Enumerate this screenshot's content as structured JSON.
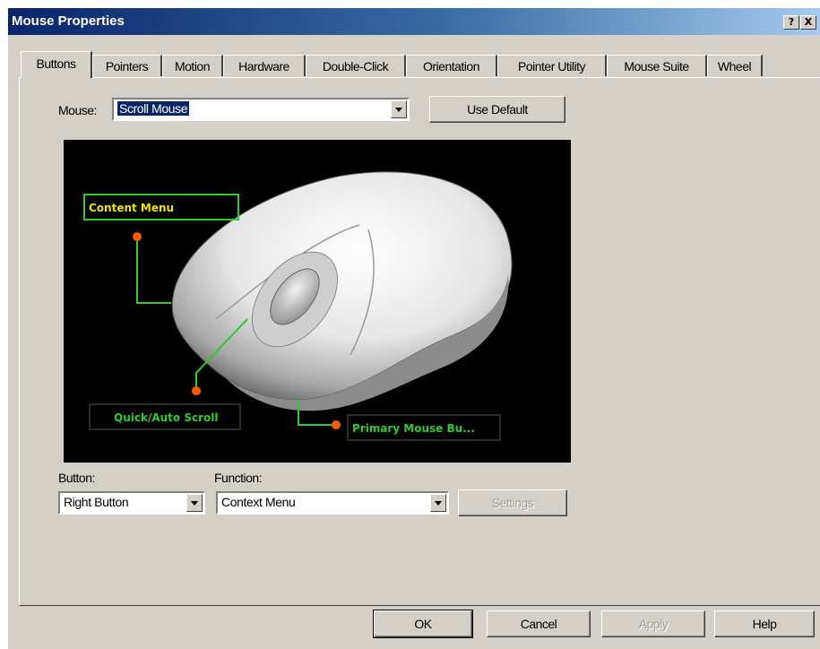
{
  "window": {
    "title": "Mouse Properties",
    "help_glyph": "?",
    "close_glyph": "X"
  },
  "tabs": [
    {
      "label": "Buttons",
      "active": true
    },
    {
      "label": "Pointers"
    },
    {
      "label": "Motion"
    },
    {
      "label": "Hardware"
    },
    {
      "label": "Double-Click"
    },
    {
      "label": "Orientation"
    },
    {
      "label": "Pointer Utility"
    },
    {
      "label": "Mouse Suite"
    },
    {
      "label": "Wheel"
    }
  ],
  "mouse_select": {
    "label": "Mouse:",
    "value": "Scroll Mouse"
  },
  "use_default_label": "Use Default",
  "preview": {
    "callouts": {
      "context": "Content Menu",
      "scroll": "Quick/Auto Scroll",
      "primary": "Primary Mouse Bu..."
    },
    "colors": {
      "context": "#e8e800",
      "green": "#2ecc2e",
      "dot": "#ff5a00"
    }
  },
  "button_select": {
    "label": "Button:",
    "value": "Right Button"
  },
  "function_select": {
    "label": "Function:",
    "value": "Context Menu"
  },
  "settings_label": "Settings",
  "footer": {
    "ok": "OK",
    "cancel": "Cancel",
    "apply": "Apply",
    "help": "Help"
  }
}
